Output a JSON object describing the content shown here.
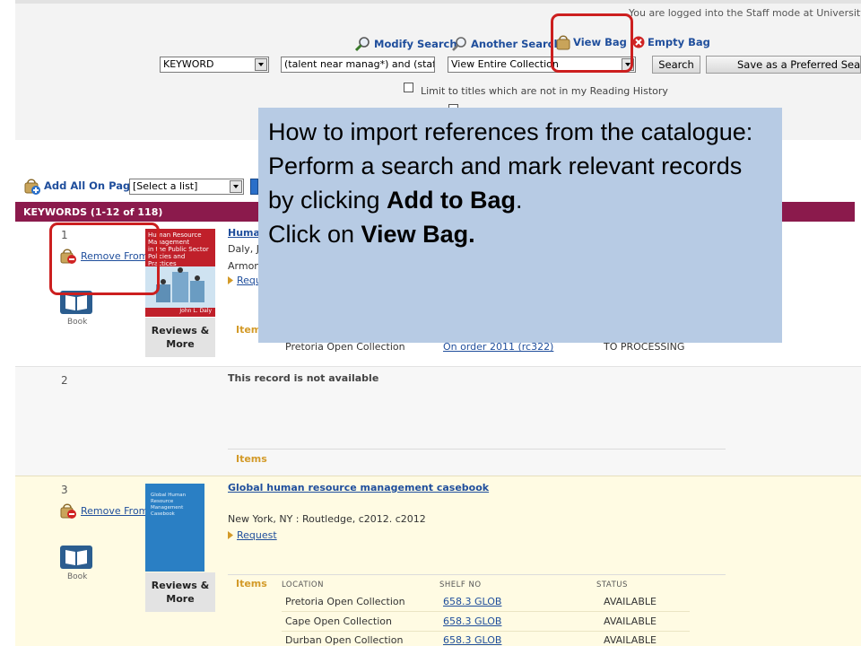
{
  "header": {
    "logged_in_text": "You are logged into the Staff mode at University of Sout",
    "links": {
      "modify_search": "Modify Search",
      "another_search": "Another Search",
      "view_bag": "View Bag",
      "empty_bag": "Empty Bag"
    }
  },
  "search_bar": {
    "field_select": "KEYWORD",
    "query_value": "(talent near manag*) and (staff* o",
    "scope_select": "View Entire Collection",
    "search_button": "Search",
    "save_button": "Save as a Preferred Search"
  },
  "limit_option": {
    "label": "Limit to titles which are not in my Reading History"
  },
  "list_tools": {
    "add_all_label": "Add All On Page",
    "list_select": "[Select a list]"
  },
  "results_bar": {
    "label": "KEYWORDS (1-12 of 118)"
  },
  "callout": {
    "line1": "How to import references from the catalogue:",
    "line2_pre": "Perform a search and mark relevant records by clicking ",
    "line2_bold": "Add to Bag",
    "line2_post": ".",
    "line3_pre": "Click on ",
    "line3_bold": "View Bag."
  },
  "results": [
    {
      "number": "1",
      "remove_label": "Remove From",
      "book_label": "Book",
      "reviews_label_1": "Reviews &",
      "reviews_label_2": "More",
      "cover_lines": [
        "Human Resource",
        "Management",
        "in the Public Sector",
        "Policies and Practices"
      ],
      "cover_author": "John L. Daly",
      "title_partial": "Human",
      "author_partial": "Daly, J",
      "publisher_partial": "Armon",
      "request_partial": "Requ",
      "items_label": "Items",
      "holding": {
        "location": "Pretoria Open Collection",
        "shelf": "On order 2011 (rc322)",
        "status": "TO PROCESSING"
      }
    },
    {
      "number": "2",
      "message": "This record is not available",
      "items_label": "Items"
    },
    {
      "number": "3",
      "remove_label": "Remove From",
      "book_label": "Book",
      "reviews_label_1": "Reviews &",
      "reviews_label_2": "More",
      "cover_lines": [
        "Global Human",
        "Resource",
        "Management",
        "Casebook"
      ],
      "title": "Global human resource management casebook",
      "publisher": "New York, NY : Routledge, c2012. c2012",
      "request_label": "Request",
      "items_label": "Items",
      "columns": {
        "location": "LOCATION",
        "shelf": "SHELF NO",
        "status": "STATUS"
      },
      "holdings": [
        {
          "location": "Pretoria Open Collection",
          "shelf": "658.3 GLOB",
          "status": "AVAILABLE"
        },
        {
          "location": "Cape Open Collection",
          "shelf": "658.3 GLOB",
          "status": "AVAILABLE"
        },
        {
          "location": "Durban Open Collection",
          "shelf": "658.3 GLOB",
          "status": "AVAILABLE"
        }
      ]
    }
  ],
  "colors": {
    "results_bar": "#8b1a4c",
    "row3_bg": "#fffbe3",
    "row2_bg": "#f7f7f7",
    "callout_bg": "#b7cbe4",
    "highlight": "#cc1f1f",
    "link": "#1f4e9c"
  }
}
